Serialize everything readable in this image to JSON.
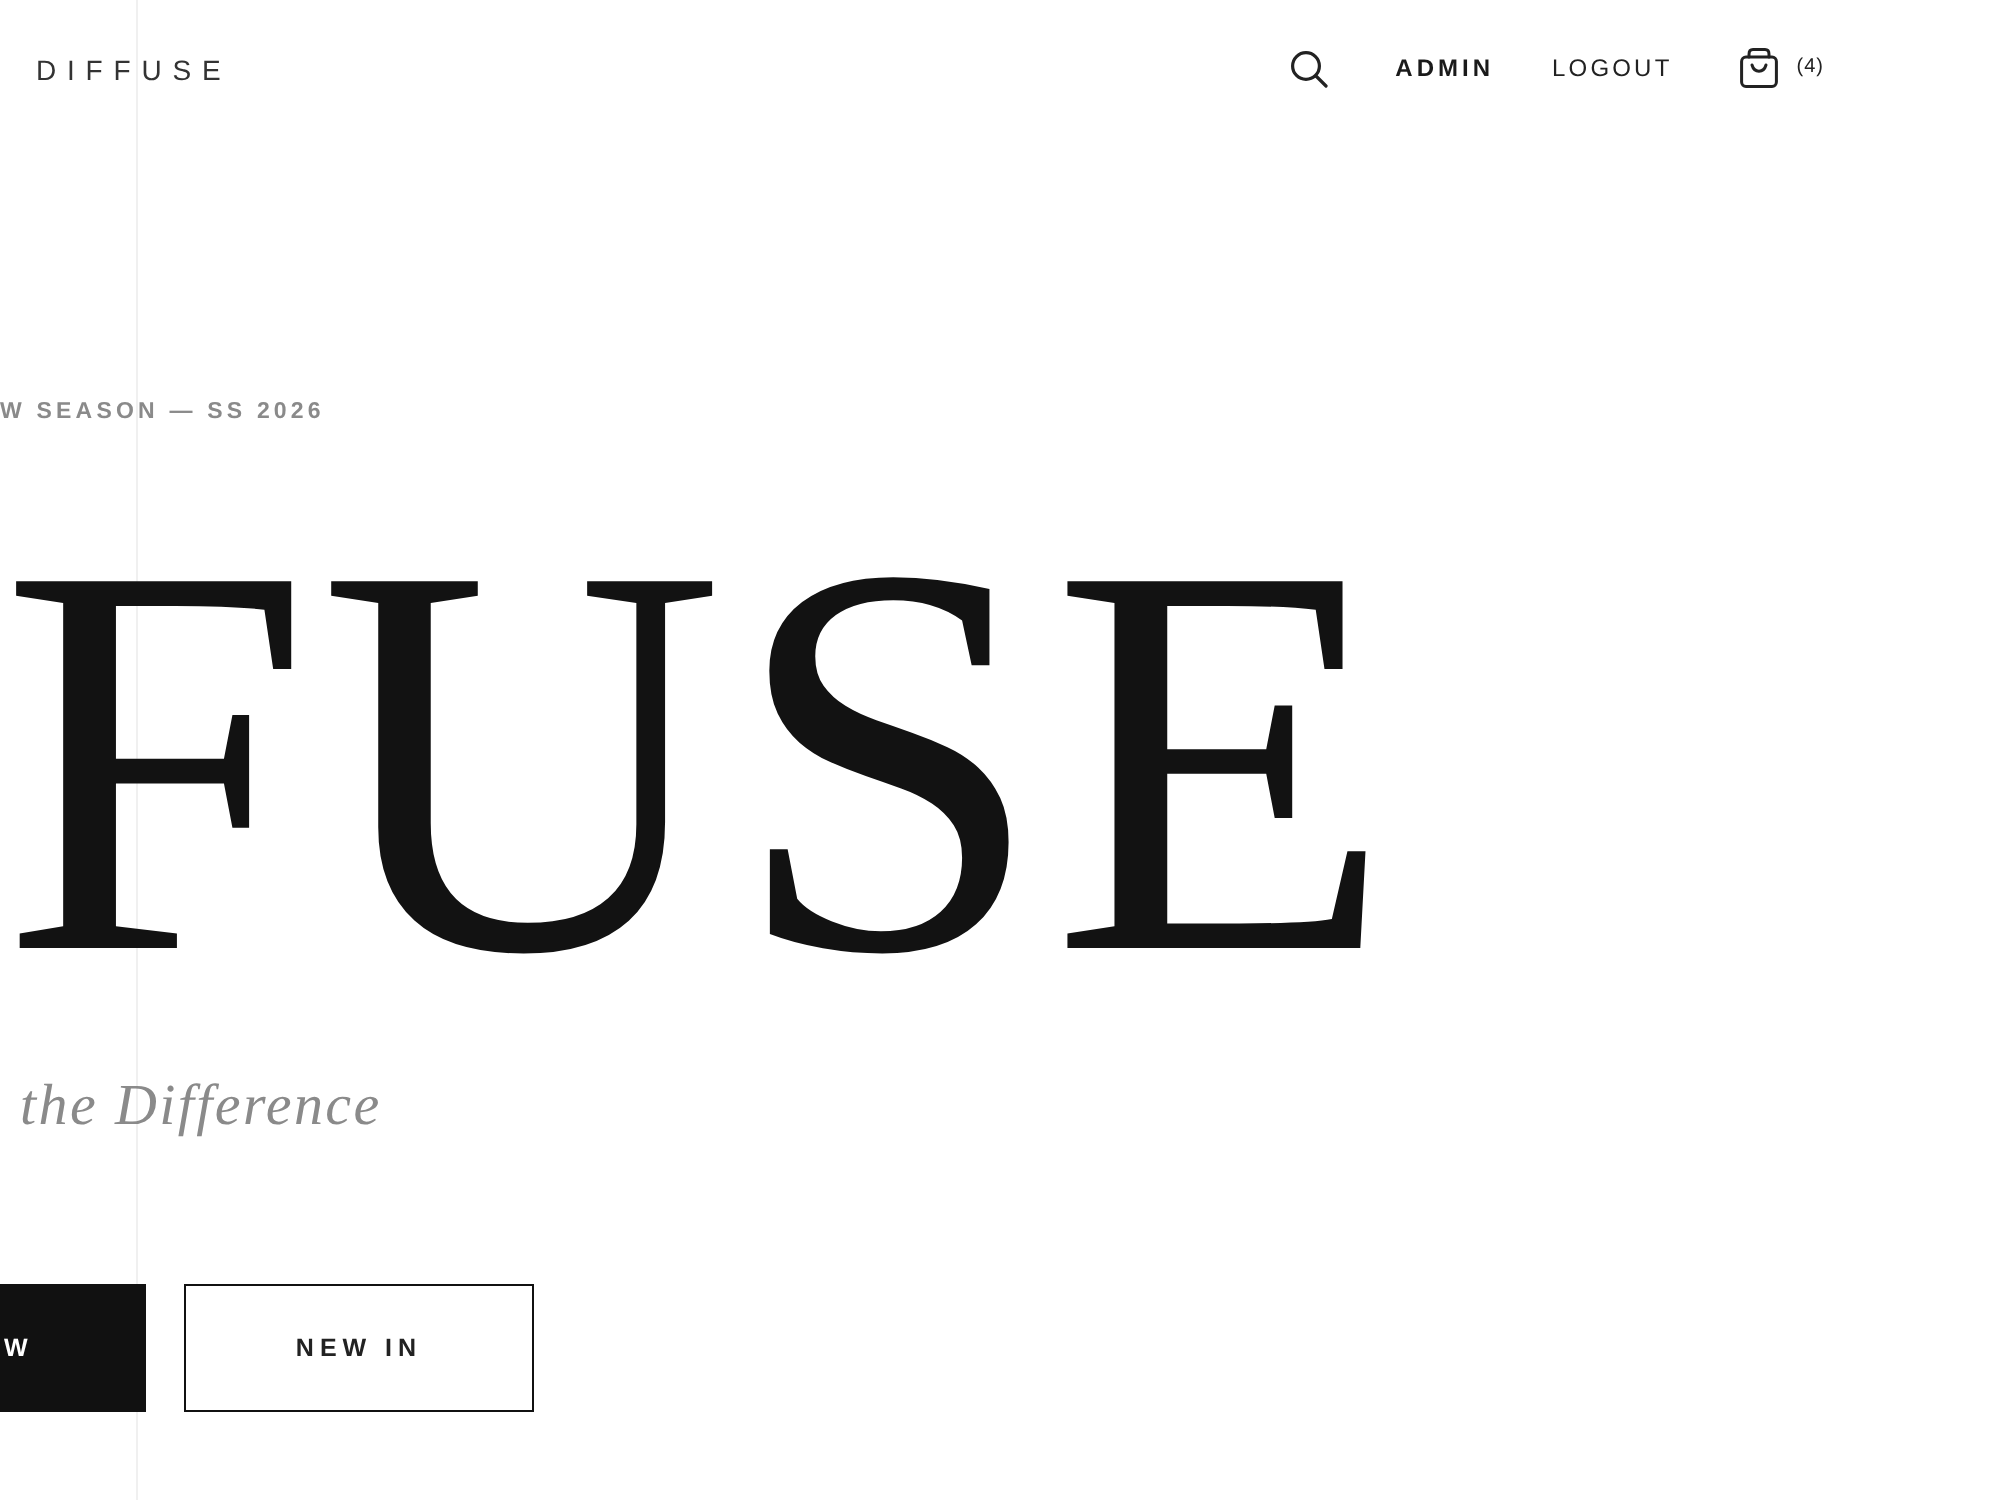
{
  "header": {
    "logo": "DIFFUSE",
    "nav_links": [
      {
        "label": "ADMIN",
        "selected": true
      },
      {
        "label": "LOGOUT",
        "selected": false
      }
    ],
    "cart": {
      "count": "(4)"
    }
  },
  "hero": {
    "eyebrow": "W SEASON — SS 2026",
    "title": "FUSE",
    "tagline": "the Difference",
    "buttons": [
      {
        "label": "W",
        "kind": "solid"
      },
      {
        "label": "NEW IN",
        "kind": "outline"
      }
    ]
  }
}
